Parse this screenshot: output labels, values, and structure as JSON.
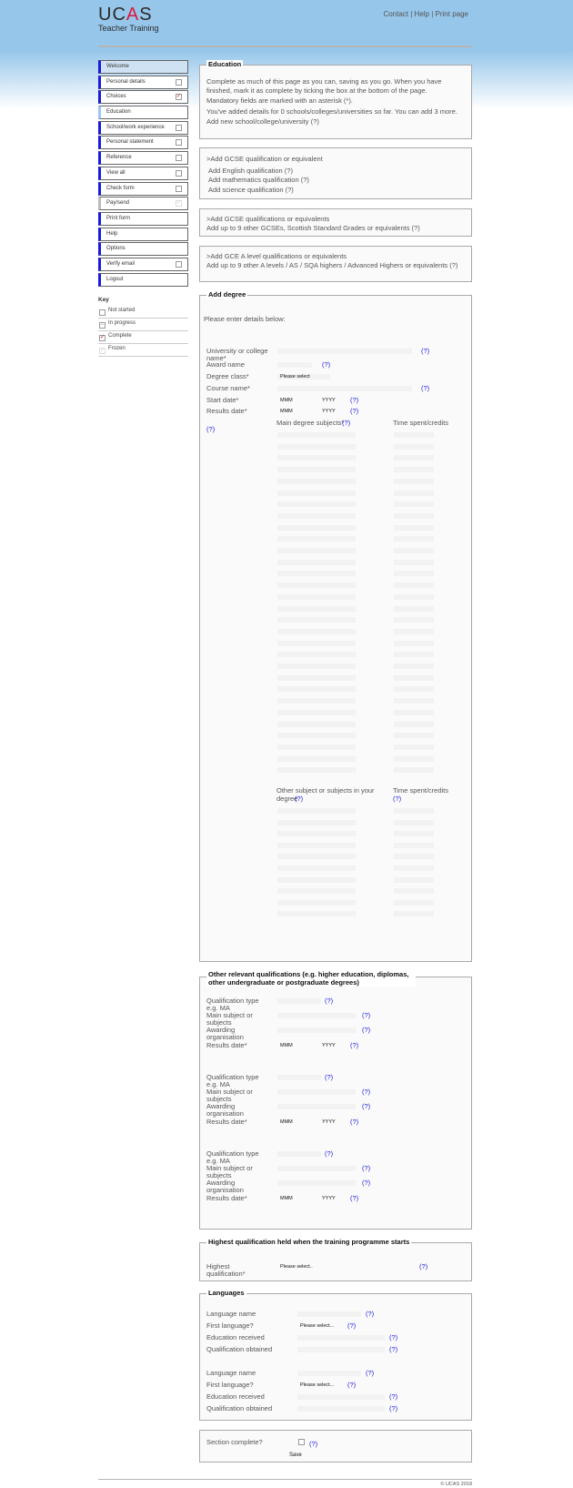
{
  "header": {
    "logo": "UCAS",
    "subtitle": "Teacher Training",
    "links": [
      "Contact",
      "Help",
      "Print page"
    ],
    "separator": " | "
  },
  "nav": {
    "items": [
      {
        "label": "Welcome",
        "check": "none",
        "style": "active"
      },
      {
        "label": "Personal details",
        "check": "empty",
        "style": "normal"
      },
      {
        "label": "Choices",
        "check": "ticked",
        "style": "normal"
      },
      {
        "label": "Education",
        "check": "none",
        "style": "light"
      },
      {
        "label": "School/work experience",
        "check": "empty",
        "style": "normal"
      },
      {
        "label": "Personal statement",
        "check": "empty",
        "style": "normal"
      },
      {
        "label": "Reference",
        "check": "empty",
        "style": "normal"
      },
      {
        "label": "View all",
        "check": "empty",
        "style": "normal"
      },
      {
        "label": "Check form",
        "check": "empty",
        "style": "normal"
      },
      {
        "label": "Pay/send",
        "check": "frozen",
        "style": "grey"
      },
      {
        "label": "Print form",
        "check": "none",
        "style": "normal"
      },
      {
        "label": "Help",
        "check": "none",
        "style": "normal"
      },
      {
        "label": "Options",
        "check": "none",
        "style": "normal"
      },
      {
        "label": "Verify email",
        "check": "empty",
        "style": "normal"
      },
      {
        "label": "Logout",
        "check": "none",
        "style": "normal"
      }
    ]
  },
  "key": {
    "title": "Key",
    "items": [
      "Not started",
      "In progress",
      "Complete",
      "Frozen"
    ]
  },
  "education": {
    "legend": "Education",
    "intro": "Complete as much of this page as you can, saving as you go. When you have finished, mark it as complete by ticking the box at the bottom of the page.",
    "mandatory": "Mandatory fields are marked with an asterisk (*).",
    "added": "You've added details for 0 schools/colleges/universities so far. You can add 3 more.",
    "add_link": "Add new school/college/university (?)"
  },
  "gcse": {
    "title": ">Add GCSE qualification or equivalent",
    "links": [
      "Add English qualification (?)",
      "Add mathematics qualification (?)",
      "Add science qualification (?)"
    ]
  },
  "gcse_other": {
    "title": ">Add GCSE qualifications or equivalents",
    "link": "Add up to 9 other GCSEs, Scottish Standard Grades or equivalents (?)"
  },
  "alevel": {
    "title": ">Add GCE A level qualifications or equivalents",
    "link": "Add up to 9 other A levels / AS / SQA highers / Advanced Highers or equivalents (?)"
  },
  "degree": {
    "legend": "Add degree",
    "intro": "Please enter details below:",
    "labels": [
      "University or college name*",
      "Award name",
      "Degree class*",
      "Course name*",
      "Start date*",
      "Results date*"
    ],
    "degree_class_value": "Please select",
    "month_placeholder": "MMM",
    "year_placeholder": "YYYY",
    "help": "(?)",
    "main_subjects": "Main degree subjects*",
    "time_spent": "Time spent/credits",
    "other_subjects": "Other subject or subjects in your degree",
    "time_spent2": "Time spent/credits"
  },
  "other_quals": {
    "legend": "Other relevant qualifications (e.g. higher education, diplomas, other undergraduate or postgraduate degrees)",
    "labels": [
      "Qualification type e.g. MA",
      "Main subject or subjects",
      "Awarding organisation",
      "Results date*"
    ]
  },
  "highest": {
    "legend": "Highest qualification held when the training programme starts",
    "label": "Highest qualification*",
    "value": "Please select.."
  },
  "languages": {
    "legend": "Languages",
    "labels": [
      "Language name",
      "First language?",
      "Education received",
      "Qualification obtained"
    ],
    "select_value": "Please select..."
  },
  "complete": {
    "label": "Section complete?",
    "save": "Save"
  },
  "footer": "© UCAS 2018"
}
